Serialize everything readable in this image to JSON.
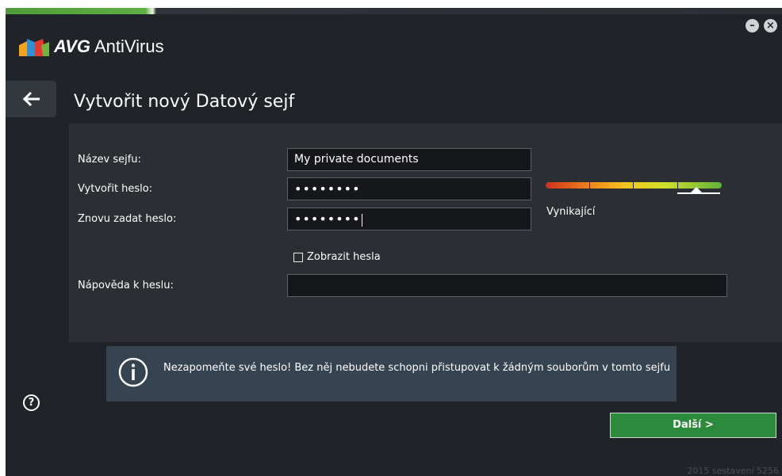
{
  "app": {
    "brand": "AVG",
    "product": "AntiVirus"
  },
  "window": {
    "minimize_label": "–",
    "close_label": "×"
  },
  "page": {
    "title": "Vytvořit nový Datový sejf"
  },
  "form": {
    "vault_name_label": "Název sejfu:",
    "vault_name_value": "My private documents",
    "password_label": "Vytvořit heslo:",
    "password_value": "••••••••",
    "password_repeat_label": "Znovu zadat heslo:",
    "password_repeat_value": "••••••••",
    "show_passwords_label": "Zobrazit hesla",
    "show_passwords_checked": false,
    "hint_label": "Nápověda k heslu:",
    "hint_value": ""
  },
  "strength": {
    "label": "Vynikající",
    "level_percent": 87
  },
  "info": {
    "text": "Nezapomeňte své heslo! Bez něj nebudete schopni přistupovat k žádným souborům v tomto sejfu"
  },
  "buttons": {
    "next_label": "Další >",
    "help_label": "?"
  },
  "footer": {
    "build": "2015 sestavení 5256"
  },
  "colors": {
    "background": "#202327",
    "panel": "#2b2f34",
    "info_box": "#364452",
    "accent_green": "#2c8a3d"
  }
}
